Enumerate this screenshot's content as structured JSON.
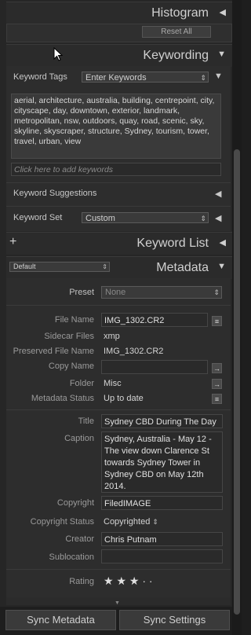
{
  "histogram": {
    "title": "Histogram",
    "reset_label": "Reset All"
  },
  "keywording": {
    "title": "Keywording",
    "tags_label": "Keyword Tags",
    "tags_select": "Enter Keywords",
    "keywords_text": "aerial, architecture, australia, building, centrepoint, city, cityscape, day, downtown, exterior, landmark, metropolitan, nsw, outdoors, quay, road, scenic, sky, skyline, skyscraper, structure, Sydney, tourism, tower, travel, urban, view",
    "add_placeholder": "Click here to add keywords",
    "suggestions_label": "Keyword Suggestions",
    "set_label": "Keyword Set",
    "set_value": "Custom"
  },
  "keyword_list": {
    "title": "Keyword List",
    "add_symbol": "+"
  },
  "metadata": {
    "title": "Metadata",
    "preset_select_left": "Default",
    "preset_label": "Preset",
    "preset_value": "None",
    "file_name_label": "File Name",
    "file_name": "IMG_1302.CR2",
    "sidecar_label": "Sidecar Files",
    "sidecar": "xmp",
    "preserved_label": "Preserved File Name",
    "preserved": "IMG_1302.CR2",
    "copy_name_label": "Copy Name",
    "copy_name": "",
    "folder_label": "Folder",
    "folder": "Misc",
    "status_label": "Metadata Status",
    "status": "Up to date",
    "title_label": "Title",
    "title_value": "Sydney CBD During The Day",
    "caption_label": "Caption",
    "caption_value": "Sydney, Australia - May 12 - The view down Clarence St towards Sydney Tower in Sydney CBD on May 12th 2014.",
    "copyright_label": "Copyright",
    "copyright_value": "FiledIMAGE",
    "copyright_status_label": "Copyright Status",
    "copyright_status": "Copyrighted",
    "creator_label": "Creator",
    "creator": "Chris Putnam",
    "sublocation_label": "Sublocation",
    "sublocation": "",
    "rating_label": "Rating",
    "rating_stars": "★ ★ ★ · ·"
  },
  "footer": {
    "sync_metadata": "Sync Metadata",
    "sync_settings": "Sync Settings"
  }
}
